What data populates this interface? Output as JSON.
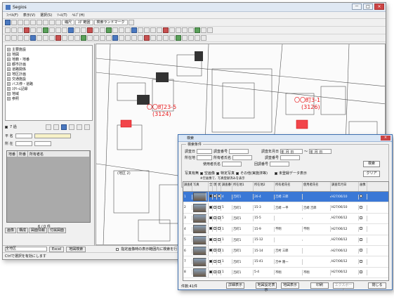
{
  "app": {
    "title": "Segios",
    "window_controls": [
      "－",
      "□",
      "×"
    ]
  },
  "menu": [
    "ﾌｧｲﾙ(F)",
    "表示(V)",
    "選択(S)",
    "ﾂｰﾙ(T)",
    "ﾍﾙﾌﾟ(H)"
  ],
  "toolbar": {
    "buttons": [
      "縮尺",
      "ｽﾀﾞ範囲",
      "検索ランドマーク"
    ]
  },
  "tree": {
    "items": [
      "主要施設",
      "地図",
      "地籍・地番",
      "都市計画",
      "道路関係",
      "地区計画",
      "交通施設",
      "バス停・道路",
      "ｽﾀﾘｰﾑ記録",
      "地域",
      "参照"
    ]
  },
  "left": {
    "zoom_label": "7 過",
    "field1": "平 名",
    "field2": "所 在",
    "grid_headers": [
      "地番",
      "所番",
      "所有者名"
    ],
    "count": "6 / 0 件",
    "tabs": [
      "画像",
      "構成",
      "図面情報",
      "付属図面"
    ]
  },
  "map": {
    "labels": [
      {
        "line1": "〇〇町23-5",
        "line2": "(3124)"
      },
      {
        "line1": "〇〇町3-1",
        "line2": "(3126)"
      }
    ],
    "mini_label": "(地区 2)"
  },
  "status": {
    "layer_select": "全地区",
    "buttons": [
      "Excel",
      "地図検索"
    ],
    "option": "指定画像時の表示範囲内に検索を行う",
    "hint": "Ctrlで選択を有効にします"
  },
  "dialog": {
    "title": "検索",
    "legend": "検索条件",
    "fields": {
      "r1": [
        "調査日",
        "調査番号",
        "調査年月日"
      ],
      "r2": [
        "所在地",
        "所有者氏名",
        "調査番号"
      ],
      "r3": [
        "使用者氏名",
        "回調番号"
      ],
      "dates": [
        "年 月 日",
        "年 月 日"
      ]
    },
    "options": [
      "写真有無",
      "空画像",
      "特定写真",
      "その他(実施済等)",
      "未登録データ表示"
    ],
    "note": "※空画像で、写真登録済みを表示",
    "buttons": {
      "search": "検索",
      "clear": "クリア"
    },
    "columns": [
      "調査番号",
      "写真",
      "全",
      "現",
      "状",
      "調査番号",
      "所在地1",
      "所在地2",
      "所有者氏名",
      "使用者氏名",
      "調査年月日",
      "画像"
    ],
    "rows": [
      {
        "n": "1",
        "c": "4",
        "a1": "吉町1",
        "a2": "26-4",
        "own": "吉崎 三郎",
        "use": "",
        "date": "H27/06/10",
        "sel": true
      },
      {
        "n": "2",
        "c": "5",
        "a1": "吉町1",
        "a2": "15-3",
        "own": "吉崎 一平",
        "use": "吉崎 吉郎",
        "date": "H27/06/10",
        "sel": false
      },
      {
        "n": "3",
        "c": "5",
        "a1": "吉町1",
        "a2": "15-5",
        "own": "",
        "use": "",
        "date": "H27/06/12",
        "sel": false
      },
      {
        "n": "4",
        "c": "1",
        "a1": "吉町1",
        "a2": "15-9",
        "own": "不明",
        "use": "不明",
        "date": "H27/06/12",
        "sel": false
      },
      {
        "n": "5",
        "c": "1",
        "a1": "吉町1",
        "a2": "15-12",
        "own": "",
        "use": "",
        "date": "H27/06/12",
        "sel": false
      },
      {
        "n": "6",
        "c": "1",
        "a1": "吉町1",
        "a2": "15-14",
        "own": "吉村 三郎",
        "use": "",
        "date": "H27/06/12",
        "sel": false
      },
      {
        "n": "7",
        "c": "1",
        "a1": "吉町1",
        "a2": "15-41",
        "own": "吉中 隆一",
        "use": "",
        "date": "H27/06/12",
        "sel": false
      },
      {
        "n": "8",
        "c": "1",
        "a1": "吉町1",
        "a2": "5-4",
        "own": "不明",
        "use": "不明",
        "date": "H27/06/12",
        "sel": false
      }
    ],
    "footer": {
      "count": "件数:41件",
      "buttons": [
        "詳細表示",
        "地図設定表示",
        "地図表示",
        "印刷",
        "エクスポート",
        "閉じる"
      ]
    }
  },
  "colors": {
    "accent": "#3a78d6",
    "parcel": "#f2454a",
    "label": "#e8181b"
  }
}
